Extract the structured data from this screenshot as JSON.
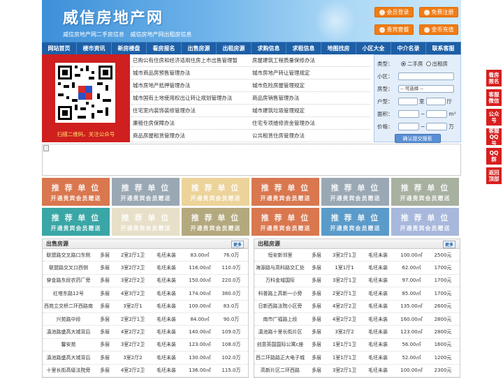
{
  "header": {
    "logo": "威信房地产网",
    "slogans": [
      "威信房地产网二手房信息",
      "威信房地产网出租房信息"
    ],
    "buttons": [
      "会员登录",
      "免费注册",
      "贵宾套餐",
      "金币充值"
    ]
  },
  "nav": [
    "网站首页",
    "楼市资讯",
    "新房楼盘",
    "看房报名",
    "出售房源",
    "出租房源",
    "求购信息",
    "求租信息",
    "地图找房",
    "小区大全",
    "中介名录",
    "联系客服"
  ],
  "qr": {
    "caption": "扫描二维码，关注公众号"
  },
  "links": [
    [
      "已购公有住房和经济适用住房上市出售管理暂",
      "房屋建筑工程质量保修办法"
    ],
    [
      "城市商品房预售管理办法",
      "城市房地产转让管理规定"
    ],
    [
      "城市房地产抵押管理办法",
      "城市危险房屋管理规定"
    ],
    [
      "城市国有土地使用权出让转让规划管理办法",
      "商品房销售管理办法"
    ],
    [
      "住宅室内装饰装修管理办法",
      "城市建筑垃圾管理规定"
    ],
    [
      "廉租住房保障办法",
      "住宅专项维修资金管理办法"
    ],
    [
      "商品房屋租赁管理办法",
      "公共租赁住房管理办法"
    ]
  ],
  "search": {
    "type_label": "类型：",
    "opt1": "二手房",
    "opt2": "出租房",
    "community_label": "小区：",
    "usage_label": "房型：",
    "usage_value": "-- 可选择 --",
    "layout_label": "户型：",
    "room": "室",
    "hall": "厅",
    "area_label": "面积：",
    "area_unit": "m²",
    "price_label": "价格：",
    "price_unit": "万",
    "submit": "确认提交搜索"
  },
  "promo": {
    "t1": "推 荐 单 位",
    "t2": "开通贵宾会员赠送",
    "colors": [
      "#d9774f",
      "#9aa8b4",
      "#ecd39a",
      "#d9774f",
      "#9aa8b4",
      "#a8b0a0",
      "#3aa6a6",
      "#e7dfc8",
      "#b3a87e",
      "#d9774f",
      "#5b9bc9",
      "#a8b8dc"
    ]
  },
  "sale": {
    "title": "出售房源",
    "more": "更多",
    "rows": [
      [
        "联盟路交叉路口东侧",
        "多层",
        "2室2厅1卫",
        "毛坯未装",
        "83.00㎡",
        "76.0万"
      ],
      [
        "联盟路交叉口西侧",
        "多层",
        "3室2厅2卫",
        "毛坯未装",
        "116.00㎡",
        "110.0万"
      ],
      [
        "穿金路东段农药厂旁",
        "多层",
        "3室2厅2卫",
        "毛坯未装",
        "150.00㎡",
        "220.0万"
      ],
      [
        "红塔东路12号",
        "多层",
        "4室3厅2卫",
        "毛坯未装",
        "174.00㎡",
        "380.0万"
      ],
      [
        "西苑立交桥二环西路南",
        "多层",
        "3室2厅1",
        "毛坯未装",
        "100.00㎡",
        "83.0万"
      ],
      [
        "兴苑路中段",
        "多层",
        "2室2厅1卫",
        "毛坯未装",
        "84.00㎡",
        "90.0万"
      ],
      [
        "滇池路盛高大城背后",
        "多层",
        "4室2厅2卫",
        "毛坯未装",
        "140.00㎡",
        "109.0万"
      ],
      [
        "馨安苑",
        "多层",
        "3室2厅2卫",
        "毛坯未装",
        "123.00㎡",
        "108.0万"
      ],
      [
        "滇池路盛高大城背后",
        "多层",
        "3室2厅2",
        "毛坯未装",
        "130.00㎡",
        "102.0万"
      ],
      [
        "十里长街高级法院旁",
        "多层",
        "4室2厅2卫",
        "毛坯未装",
        "136.00㎡",
        "115.0万"
      ]
    ]
  },
  "rent": {
    "title": "出租房源",
    "more": "更多",
    "rows": [
      [
        "恒安新邻里",
        "多层",
        "3室2厅1卫",
        "毛坯未装",
        "100.00㎡",
        "2500元"
      ],
      [
        "海源路与高科路交汇处",
        "多层",
        "1室1厅1",
        "毛坯未装",
        "62.00㎡",
        "1700元"
      ],
      [
        "万科金域国际",
        "多层",
        "3室2厅1卫",
        "毛坯未装",
        "97.00㎡",
        "1700元"
      ],
      [
        "科普路上高新一小旁",
        "多层",
        "2室2厅1卫",
        "毛坯未装",
        "85.00㎡",
        "1700元"
      ],
      [
        "日新西路法院小区旁",
        "多层",
        "4室2厅2卫",
        "毛坯未装",
        "135.00㎡",
        "2600元"
      ],
      [
        "南市广福路上段",
        "多层",
        "4室2厅2卫",
        "毛坯未装",
        "160.00㎡",
        "2800元"
      ],
      [
        "滇池路十里长街片区",
        "多层",
        "3室2厅2",
        "毛坯未装",
        "123.00㎡",
        "2800元"
      ],
      [
        "创意英国国际公寓c座",
        "多层",
        "1室1厅1卫",
        "毛坯未装",
        "56.00㎡",
        "1600元"
      ],
      [
        "西二环路路正大电子城",
        "多层",
        "1室1厅1卫",
        "毛坯未装",
        "52.00㎡",
        "1200元"
      ],
      [
        "高新片区二环西路",
        "多层",
        "3室2厅1卫",
        "毛坯未装",
        "100.00㎡",
        "2300元"
      ]
    ]
  },
  "side": [
    "看房报名",
    "客服微信",
    "公众号",
    "客服QQ号",
    "QQ群",
    "返回顶部"
  ]
}
